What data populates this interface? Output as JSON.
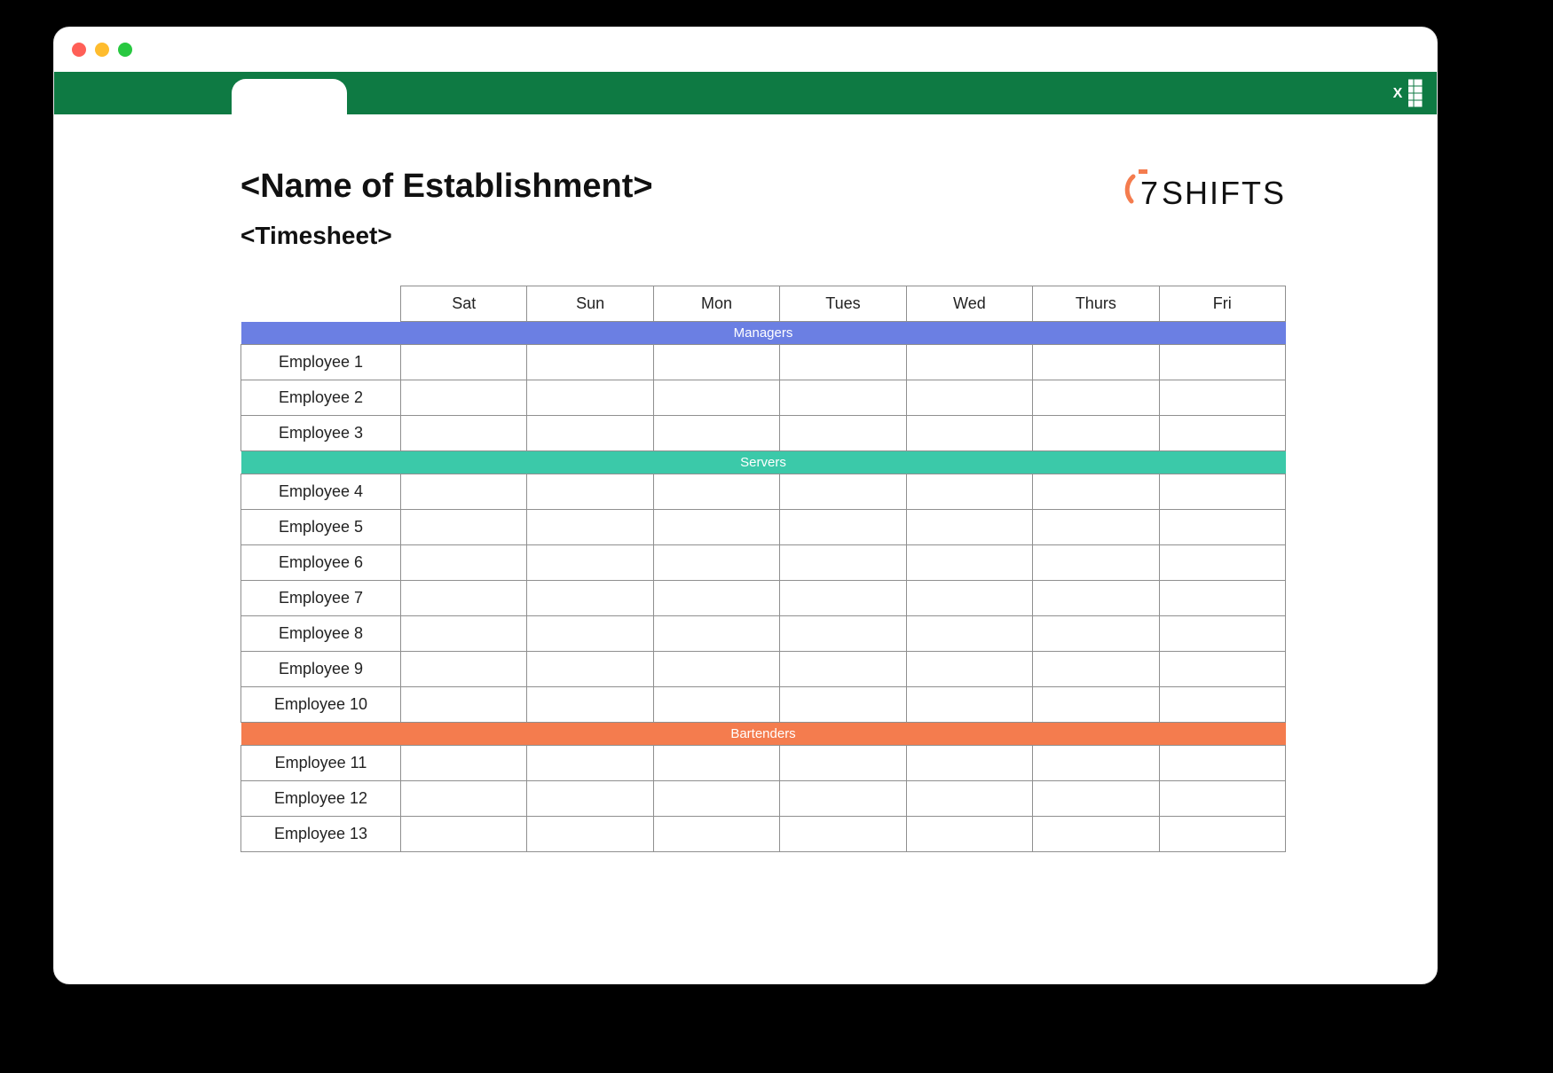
{
  "header": {
    "title": "<Name of Establishment>",
    "subtitle": "<Timesheet>"
  },
  "logo": {
    "text": "SHIFTS",
    "seven": "7"
  },
  "days": [
    "Sat",
    "Sun",
    "Mon",
    "Tues",
    "Wed",
    "Thurs",
    "Fri"
  ],
  "sections": [
    {
      "name": "Managers",
      "class": "managers",
      "employees": [
        "Employee 1",
        "Employee 2",
        "Employee 3"
      ]
    },
    {
      "name": "Servers",
      "class": "servers",
      "employees": [
        "Employee 4",
        "Employee 5",
        "Employee 6",
        "Employee 7",
        "Employee 8",
        "Employee 9",
        "Employee 10"
      ]
    },
    {
      "name": "Bartenders",
      "class": "bartenders",
      "employees": [
        "Employee 11",
        "Employee 12",
        "Employee 13"
      ]
    }
  ]
}
